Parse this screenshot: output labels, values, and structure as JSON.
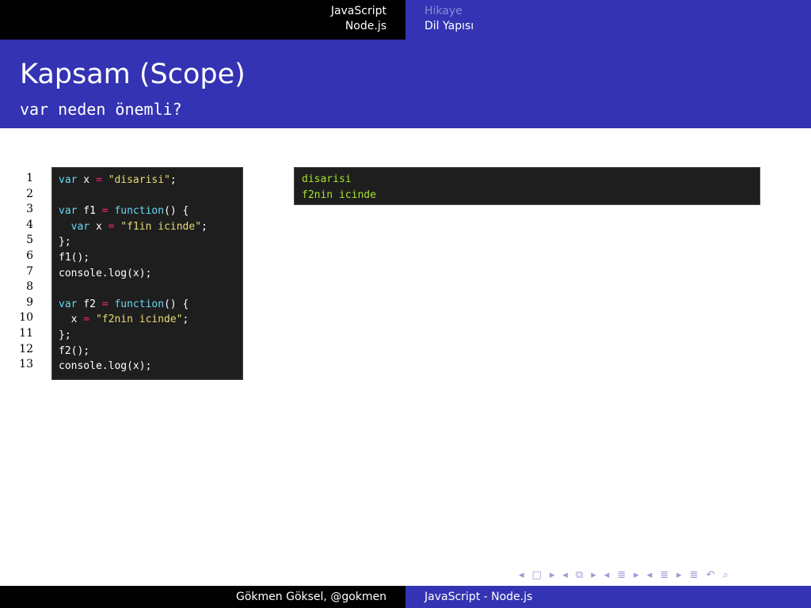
{
  "header": {
    "left_section": "JavaScript",
    "left_subsection": "Node.js",
    "right_section": "Hikaye",
    "right_subsection": "Dil Yapısı"
  },
  "frame": {
    "title": "Kapsam (Scope)",
    "subtitle": "var neden önemli?"
  },
  "code": {
    "line_numbers": [
      "1",
      "2",
      "3",
      "4",
      "5",
      "6",
      "7",
      "8",
      "9",
      "10",
      "11",
      "12",
      "13"
    ],
    "lines": [
      "var x = \"disarisi\";",
      "",
      "var f1 = function() {",
      "  var x = \"f1in icinde\";",
      "};",
      "f1();",
      "console.log(x);",
      "",
      "var f2 = function() {",
      "  x = \"f2nin icinde\";",
      "};",
      "f2();",
      "console.log(x);"
    ]
  },
  "output": {
    "lines": [
      "disarisi",
      "f2nin icinde"
    ]
  },
  "nav_symbols": {
    "frame_back": "◂",
    "frame_icon": "□",
    "frame_fwd": "▸",
    "subsection_back": "◂",
    "subsection_icon": "⧉",
    "subsection_fwd": "▸",
    "section_back": "◂",
    "section_icon": "≣",
    "section_fwd": "▸",
    "doc_back": "◂",
    "doc_icon": "≣",
    "doc_fwd": "▸",
    "appendix_icon": "≣",
    "undo_icon": "↶",
    "search_icon": "⌕"
  },
  "footer": {
    "author": "Gökmen Göksel, @gokmen",
    "title": "JavaScript - Node.js"
  },
  "colors": {
    "beamer_blue": "#3333b3",
    "code_bg": "#1e1e1e",
    "output_text": "#a6e22e"
  }
}
